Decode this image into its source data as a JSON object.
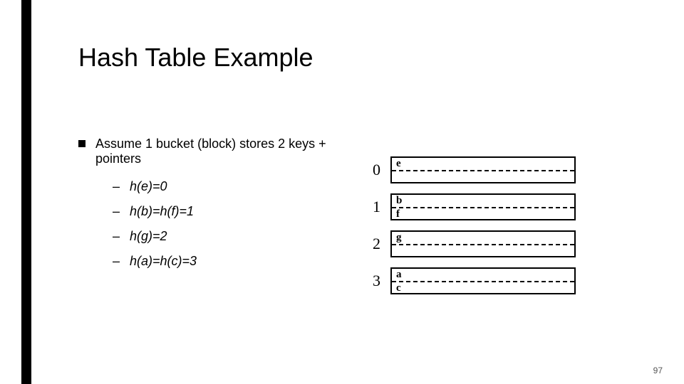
{
  "title": "Hash Table Example",
  "bullet_l1": "Assume 1 bucket (block) stores 2 keys + pointers",
  "subitems": [
    "h(e)=0",
    "h(b)=h(f)=1",
    "h(g)=2",
    "h(a)=h(c)=3"
  ],
  "buckets": [
    {
      "index": "0",
      "slot1": "e",
      "slot2": ""
    },
    {
      "index": "1",
      "slot1": "b",
      "slot2": "f"
    },
    {
      "index": "2",
      "slot1": "g",
      "slot2": ""
    },
    {
      "index": "3",
      "slot1": "a",
      "slot2": "c"
    }
  ],
  "page_number": "97"
}
